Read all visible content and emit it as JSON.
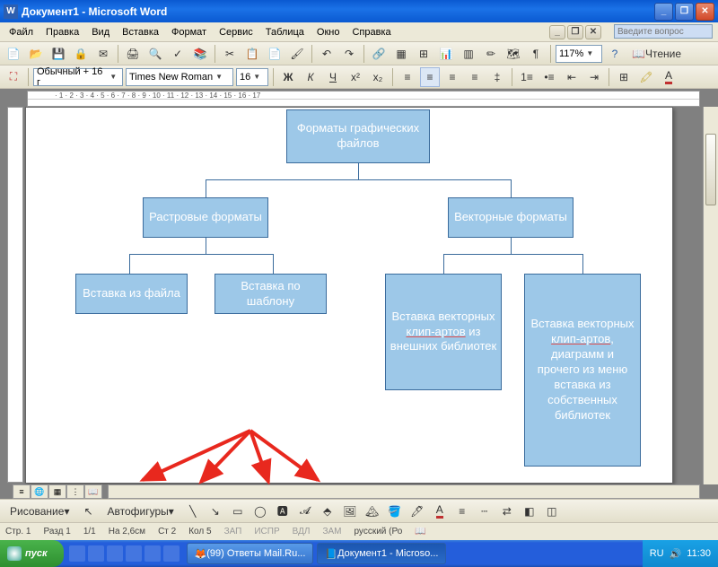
{
  "titlebar": {
    "title": "Документ1 - Microsoft Word"
  },
  "menu": {
    "file": "Файл",
    "edit": "Правка",
    "view": "Вид",
    "insert": "Вставка",
    "format": "Формат",
    "service": "Сервис",
    "table": "Таблица",
    "window": "Окно",
    "help": "Справка",
    "question_ph": "Введите вопрос"
  },
  "toolbar": {
    "zoom": "117%",
    "read": "Чтение",
    "style": "Обычный + 16 г",
    "font": "Times New Roman",
    "size": "16"
  },
  "chart_data": {
    "type": "tree",
    "root": {
      "label": "Форматы графических файлов",
      "children": [
        {
          "label": "Растровые форматы",
          "children": [
            {
              "label": "Вставка из файла"
            },
            {
              "label": "Вставка по шаблону"
            }
          ]
        },
        {
          "label": "Векторные форматы",
          "children": [
            {
              "label": "Вставка векторных клип-артов из внешних библиотек"
            },
            {
              "label": "Вставка векторных клип-артов, диаграмм и прочего из меню вставка из собственных библиотек"
            }
          ]
        }
      ]
    }
  },
  "drawbar": {
    "drawing": "Рисование",
    "autoshapes": "Автофигуры"
  },
  "status": {
    "page": "Стр. 1",
    "section": "Разд 1",
    "pages": "1/1",
    "at": "На 2,6см",
    "line": "Ст 2",
    "col": "Кол 5",
    "rec": "ЗАП",
    "trk": "ИСПР",
    "ext": "ВДЛ",
    "ovr": "ЗАМ",
    "lang": "русский (Ро"
  },
  "taskbar": {
    "start": "пуск",
    "task1": "(99) Ответы Mail.Ru...",
    "task2": "Документ1 - Microso...",
    "lang": "RU",
    "time": "11:30"
  }
}
